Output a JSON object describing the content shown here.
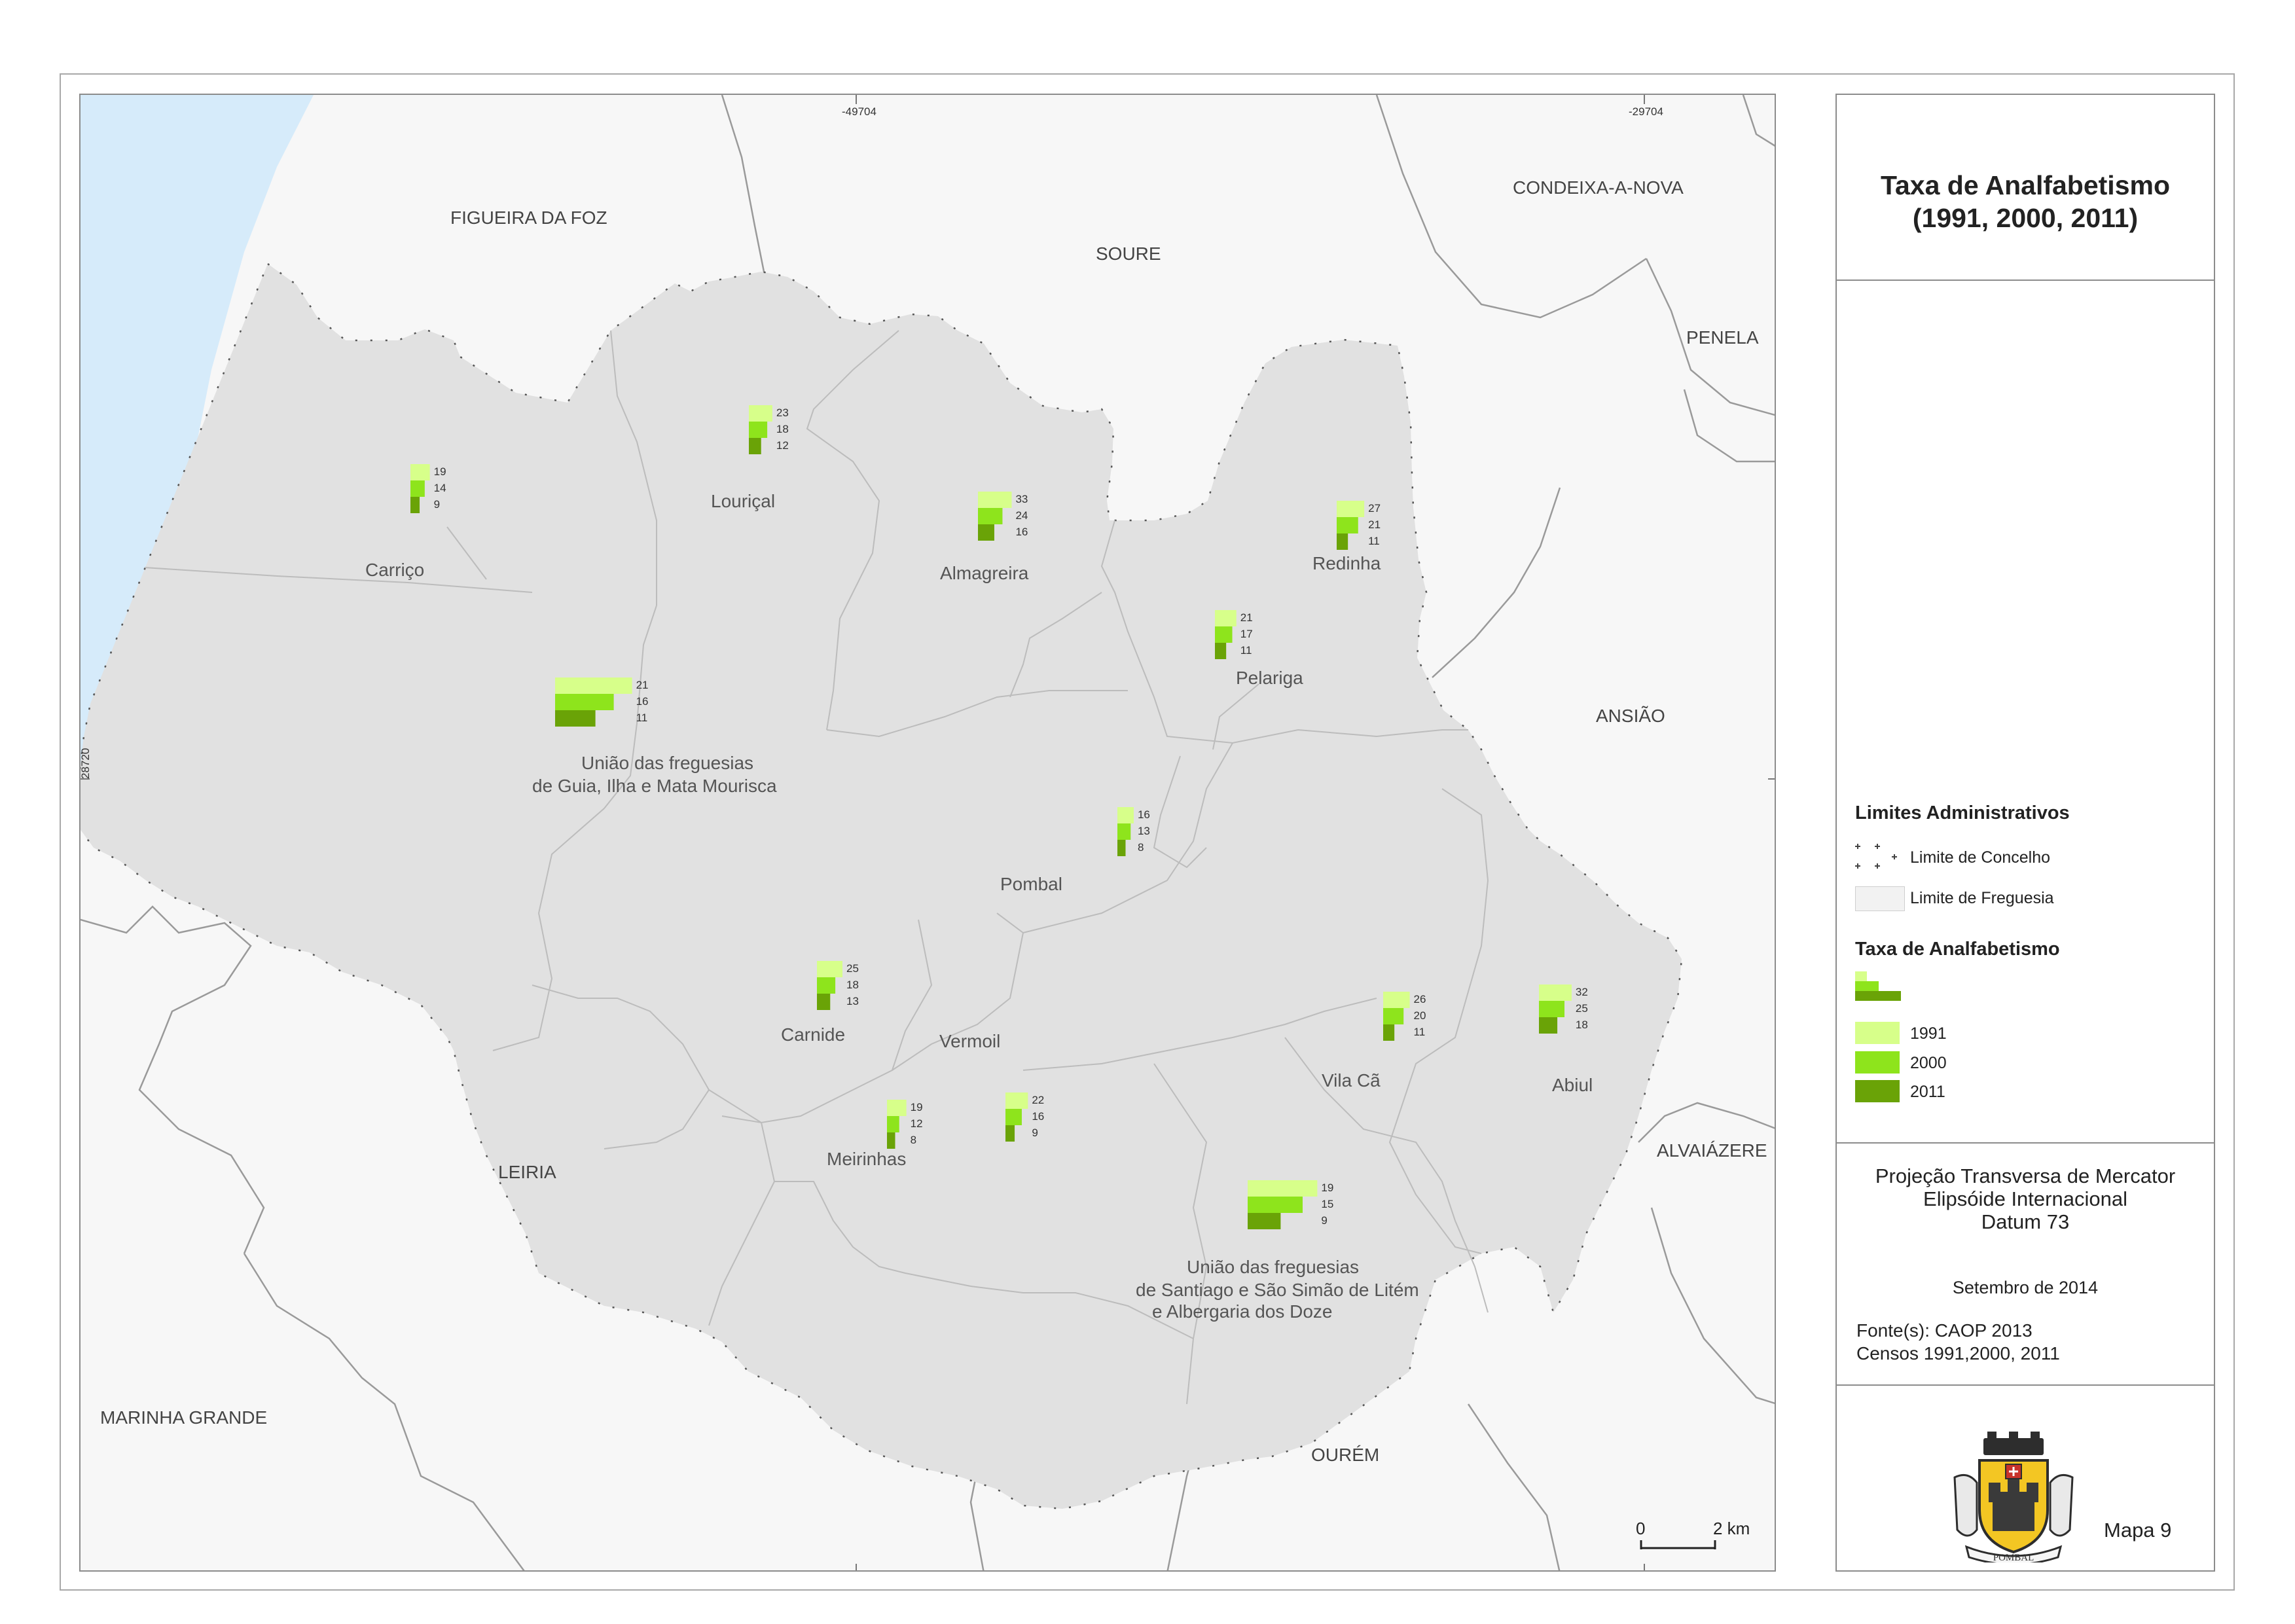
{
  "map": {
    "grid_labels": {
      "top_left": "-49704",
      "top_right": "-29704",
      "left": "28720"
    },
    "neighbors": {
      "figueira": "FIGUEIRA DA FOZ",
      "soure": "SOURE",
      "condeixa": "CONDEIXA-A-NOVA",
      "penela": "PENELA",
      "ansiao": "ANSIÃO",
      "alvaiazere": "ALVAIÁZERE",
      "leiria": "LEIRIA",
      "marinha": "MARINHA GRANDE",
      "ourem": "OURÉM"
    },
    "parishes": [
      {
        "id": "carrico",
        "lines": [
          "Carriço"
        ],
        "v1991": 19,
        "v2000": 14,
        "v2011": 9
      },
      {
        "id": "louricol",
        "lines": [
          "Louriçal"
        ],
        "v1991": 23,
        "v2000": 18,
        "v2011": 12
      },
      {
        "id": "almagreira",
        "lines": [
          "Almagreira"
        ],
        "v1991": 33,
        "v2000": 24,
        "v2011": 16
      },
      {
        "id": "redinha",
        "lines": [
          "Redinha"
        ],
        "v1991": 27,
        "v2000": 21,
        "v2011": 11
      },
      {
        "id": "pelariga",
        "lines": [
          "Pelariga"
        ],
        "v1991": 21,
        "v2000": 17,
        "v2011": 11
      },
      {
        "id": "guia",
        "lines": [
          "União das freguesias",
          "de Guia, Ilha e Mata Mourisca"
        ],
        "v1991": 21,
        "v2000": 16,
        "v2011": 11
      },
      {
        "id": "pombal",
        "lines": [
          "Pombal"
        ],
        "v1991": 16,
        "v2000": 13,
        "v2011": 8
      },
      {
        "id": "carnide",
        "lines": [
          "Carnide"
        ],
        "v1991": 25,
        "v2000": 18,
        "v2011": 13
      },
      {
        "id": "vermoil",
        "lines": [
          "Vermoil"
        ],
        "v1991": 22,
        "v2000": 16,
        "v2011": 9
      },
      {
        "id": "meirinhas",
        "lines": [
          "Meirinhas"
        ],
        "v1991": 19,
        "v2000": 12,
        "v2011": 8
      },
      {
        "id": "vilaca",
        "lines": [
          "Vila Cã"
        ],
        "v1991": 26,
        "v2000": 20,
        "v2011": 11
      },
      {
        "id": "abiul",
        "lines": [
          "Abiul"
        ],
        "v1991": 32,
        "v2000": 25,
        "v2011": 18
      },
      {
        "id": "santiago",
        "lines": [
          "União das freguesias",
          "de Santiago e São Simão de Litém",
          "e Albergaria dos Doze"
        ],
        "v1991": 19,
        "v2000": 15,
        "v2011": 9
      }
    ],
    "scale": {
      "zero": "0",
      "end": "2 km"
    },
    "colors": {
      "sea": "#d6ebfa",
      "municipality": "#e1e1e1",
      "outside": "#f7f7f7",
      "c1991": "#d7ff8a",
      "c2000": "#8ee41c",
      "c2011": "#6aa307"
    }
  },
  "title": {
    "line1": "Taxa de Analfabetismo",
    "line2": "(1991, 2000, 2011)"
  },
  "legend": {
    "admin_title": "Limites Administrativos",
    "concelho": "Limite de Concelho",
    "freguesia": "Limite de Freguesia",
    "rate_title": "Taxa de Analfabetismo",
    "y1991": "1991",
    "y2000": "2000",
    "y2011": "2011"
  },
  "projection": {
    "line1": "Projeção Transversa de Mercator",
    "line2": "Elipsóide Internacional",
    "line3": "Datum 73"
  },
  "date": "Setembro de 2014",
  "source": {
    "line1": "Fonte(s): CAOP 2013",
    "line2": "Censos 1991,2000, 2011"
  },
  "seal_text": "POMBAL",
  "map_number": "Mapa 9"
}
